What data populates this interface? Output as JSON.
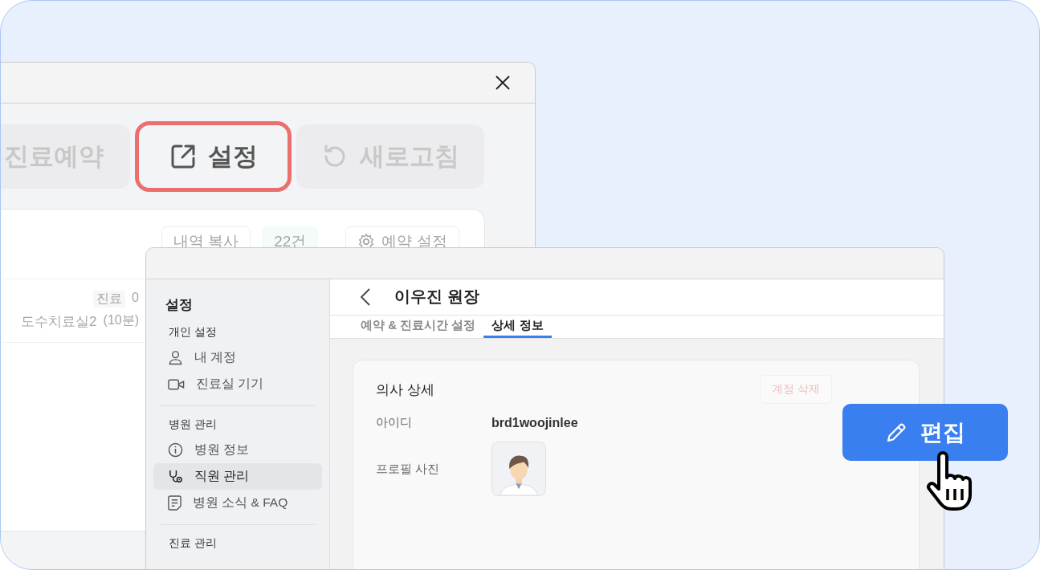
{
  "back_window": {
    "toolbar_buttons": [
      {
        "label": "진료예약",
        "kind": "plain",
        "highlighted": false
      },
      {
        "label": "설정",
        "kind": "external",
        "highlighted": true
      },
      {
        "label": "새로고침",
        "kind": "refresh",
        "highlighted": false
      }
    ],
    "panel_buttons": [
      {
        "label": "내역 복사",
        "kind": "plain"
      },
      {
        "label": "22건",
        "kind": "count"
      },
      {
        "label": "예약 설정",
        "kind": "gear"
      }
    ],
    "room": {
      "label": "진료",
      "count": "0",
      "name": "도수치료실2",
      "duration": "(10분)"
    }
  },
  "settings_window": {
    "sidebar": {
      "title": "설정",
      "sections": [
        {
          "title": "개인 설정",
          "items": [
            {
              "label": "내 계정",
              "kind": "person",
              "selected": false
            },
            {
              "label": "진료실 기기",
              "kind": "camera",
              "selected": false
            }
          ]
        },
        {
          "title": "병원 관리",
          "items": [
            {
              "label": "병원 정보",
              "kind": "info",
              "selected": false
            },
            {
              "label": "직원 관리",
              "kind": "stethoscope",
              "selected": true
            },
            {
              "label": "병원 소식 & FAQ",
              "kind": "document",
              "selected": false
            }
          ]
        },
        {
          "title": "진료 관리"
        }
      ]
    },
    "header": {
      "title": "이우진 원장"
    },
    "tabs": [
      {
        "label": "예약 & 진료시간 설정",
        "selected": false
      },
      {
        "label": "상세 정보",
        "selected": true
      }
    ],
    "card": {
      "title": "의사 상세",
      "delete_button": "계정 삭제",
      "fields": [
        {
          "label": "아이디",
          "kind": "text",
          "value": "brd1woojinlee"
        },
        {
          "label": "프로필 사진",
          "kind": "photo"
        }
      ]
    }
  },
  "edit_button": {
    "label": "편집"
  }
}
